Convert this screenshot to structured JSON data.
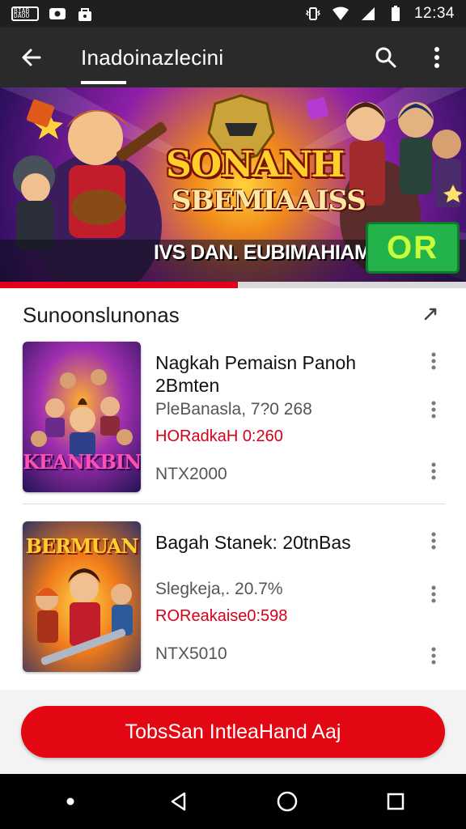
{
  "status_bar": {
    "time": "12:34",
    "mini_icon_text": "BIAB DAOO",
    "icons": [
      "notification-icon",
      "photo-icon",
      "vibrate-icon",
      "wifi-icon",
      "signal-icon",
      "battery-icon"
    ]
  },
  "toolbar": {
    "title": "Inadoinazlecini",
    "back_icon": "arrow-back-icon",
    "search_icon": "search-icon",
    "menu_icon": "more-vert-icon"
  },
  "banner": {
    "title": "SONANH",
    "subtitle": "SBEMIAAISS",
    "promo_text": "IVS DAN. EUBIMAHIAM.",
    "cta_label": "OR",
    "progress": 0.51,
    "colors": {
      "accent": "#e3001b",
      "cta": "#24b34a"
    }
  },
  "section": {
    "header": "Sunoonslunonas",
    "action_icon": "refresh-icon"
  },
  "products": [
    {
      "thumb_text": "KEANKBIN",
      "title": "Nagkah Pemaisn Panoh 2Bmten",
      "info": "PleBanasla, 7?0 268",
      "sale": "HORadkaH 0:260",
      "price": "NTX2000"
    },
    {
      "thumb_text": "BERMUAN",
      "title": "Bagah Stanek: 20tnBas",
      "info": "Slegkeja,. 20.7%",
      "sale": "ROReakaise0:598",
      "price": "NTX5010"
    }
  ],
  "bottom_button": {
    "label": "TobsSan IntleaHand Aaj",
    "color": "#e30613"
  },
  "nav": {
    "icons": [
      "dot-icon",
      "back-triangle-icon",
      "home-circle-icon",
      "recents-square-icon"
    ]
  }
}
